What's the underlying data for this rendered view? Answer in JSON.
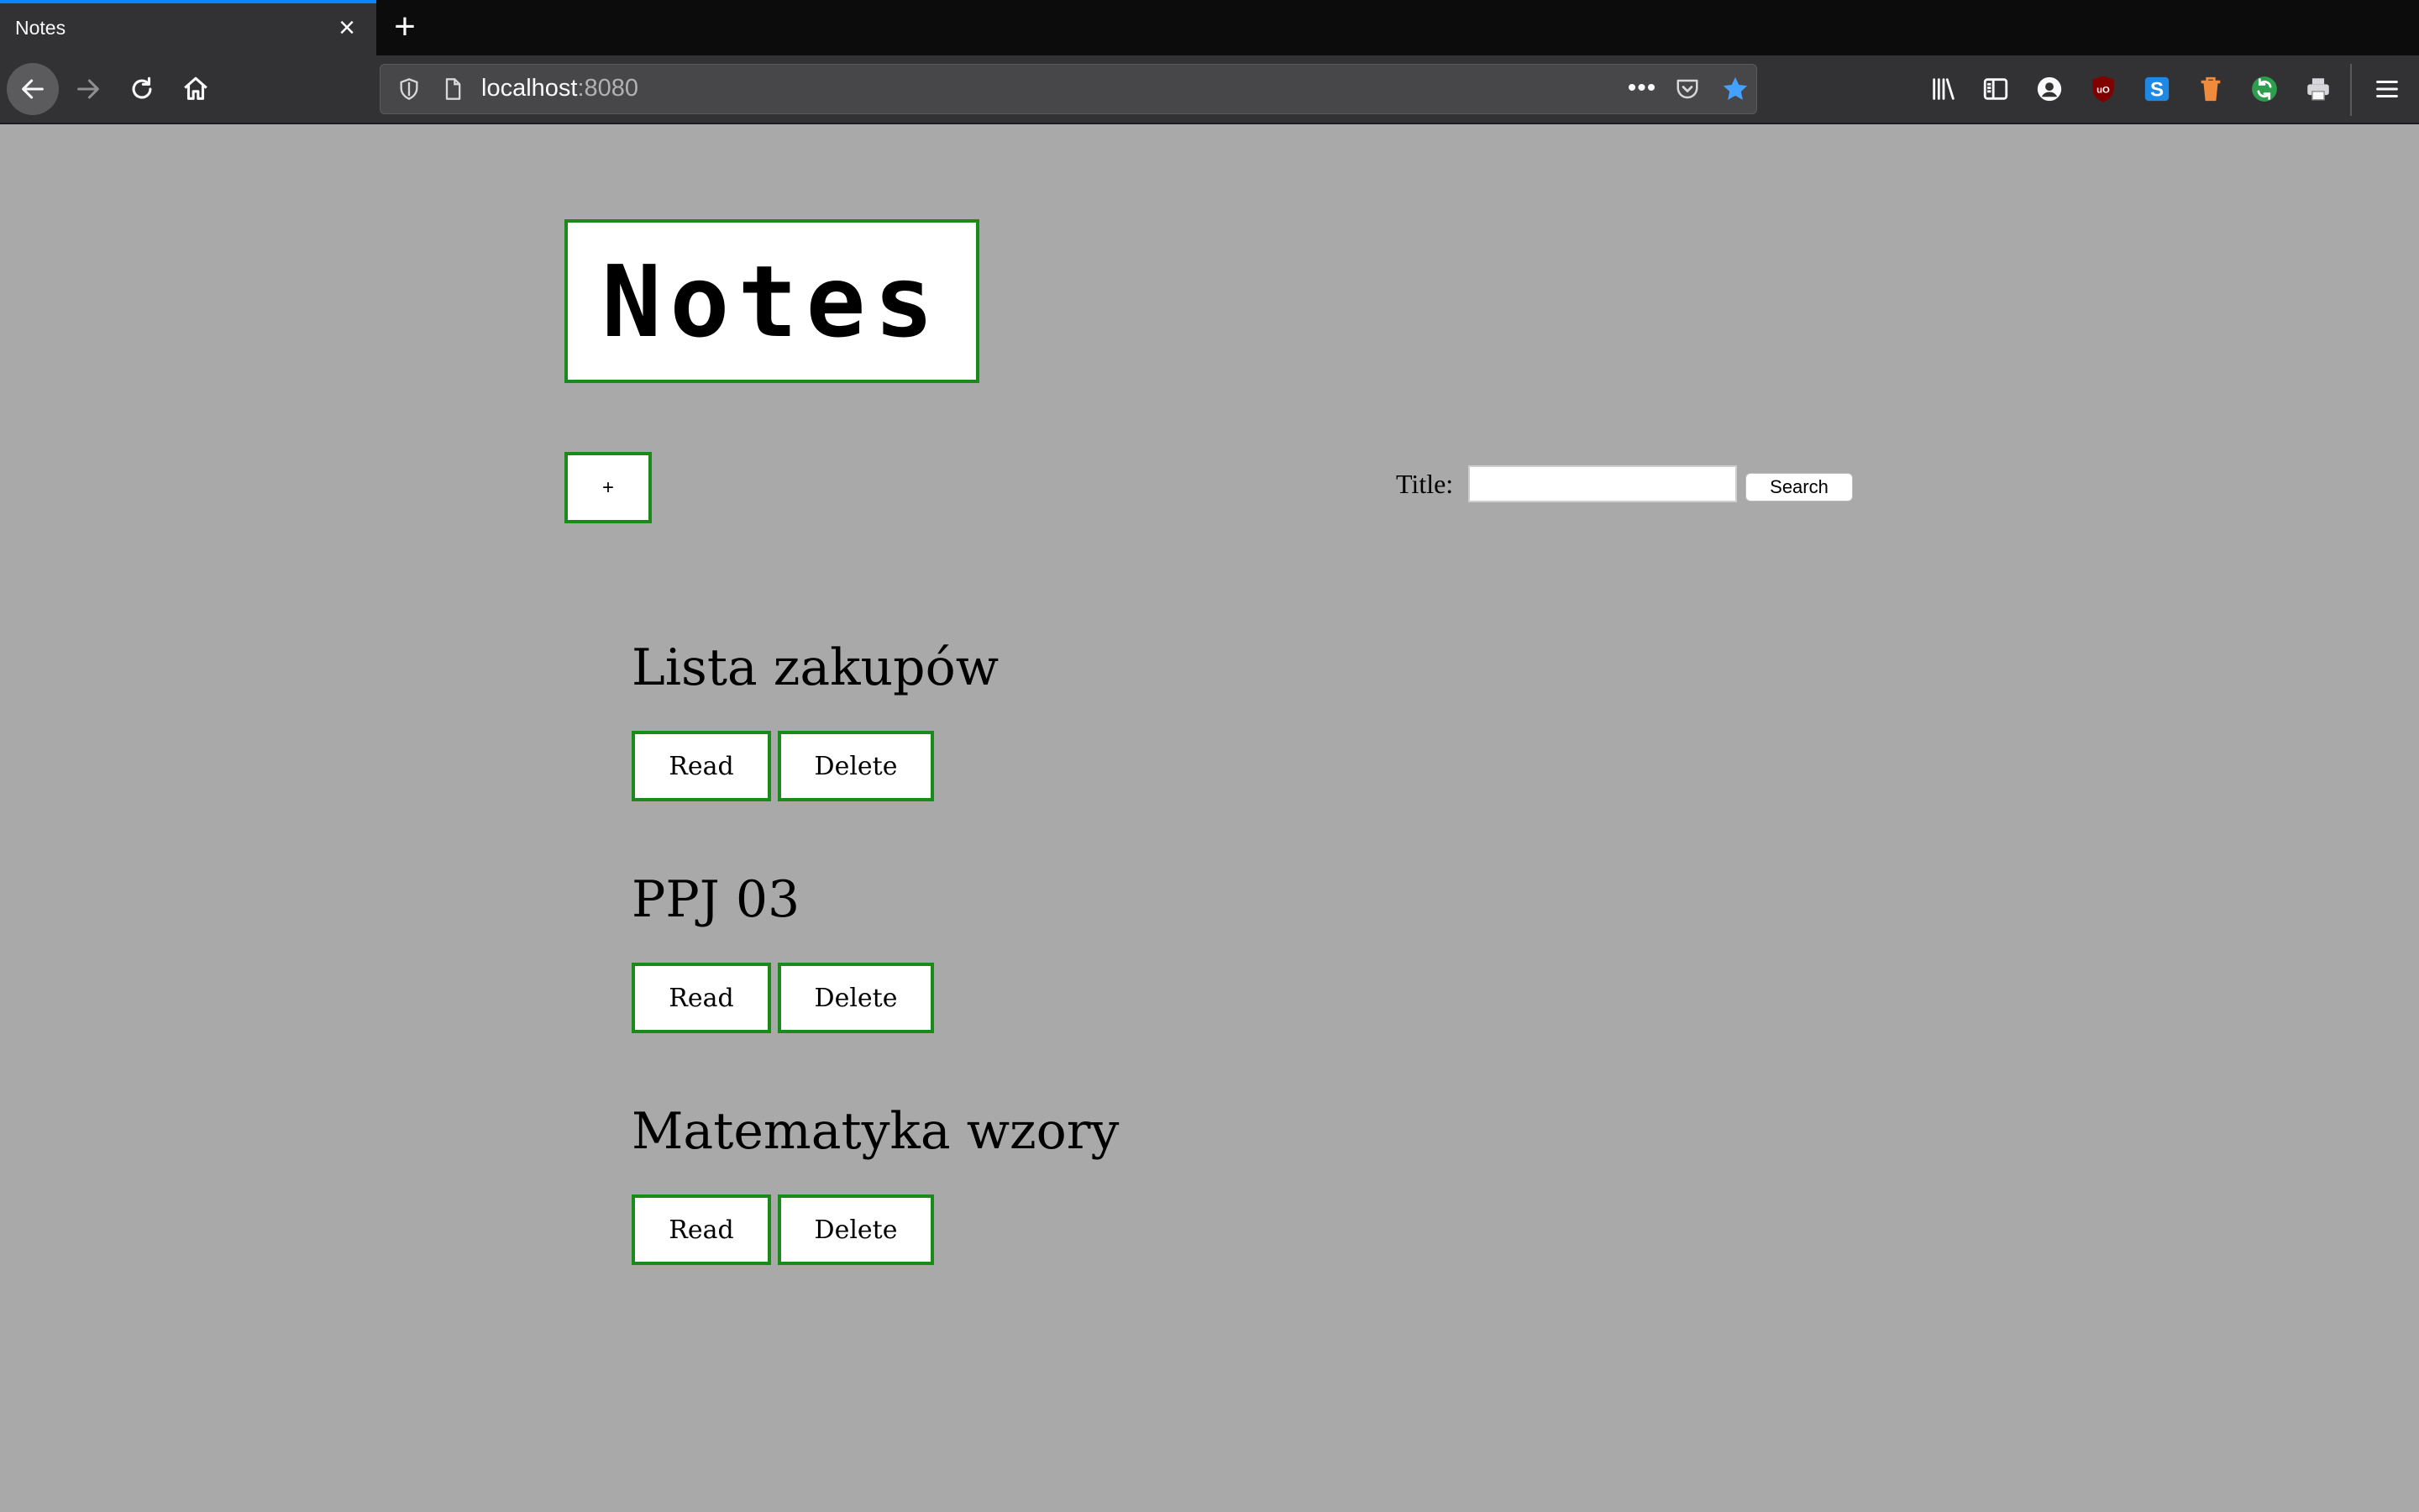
{
  "browser": {
    "tab_title": "Notes",
    "url_host": "localhost",
    "url_port": ":8080",
    "accent_color": "#0a84ff"
  },
  "page": {
    "logo_text": "Notes",
    "add_button_label": "+",
    "search": {
      "label": "Title:",
      "value": "",
      "button_label": "Search"
    },
    "notes": [
      {
        "title": "Lista zakupów",
        "read_label": "Read",
        "delete_label": "Delete"
      },
      {
        "title": "PPJ 03",
        "read_label": "Read",
        "delete_label": "Delete"
      },
      {
        "title": "Matematyka wzory",
        "read_label": "Read",
        "delete_label": "Delete"
      }
    ],
    "colors": {
      "background": "#a9a9a9",
      "border": "#1a8a1a"
    }
  }
}
